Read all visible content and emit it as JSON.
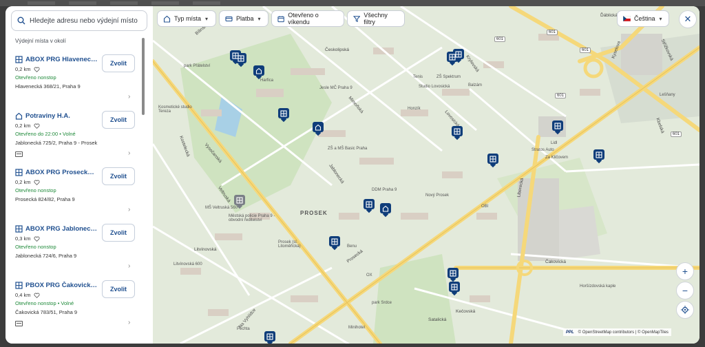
{
  "search": {
    "placeholder": "Hledejte adresu nebo výdejní místo"
  },
  "sidebar": {
    "section_label": "Výdejní místa v okolí",
    "select_label": "Zvolit",
    "places": [
      {
        "type": "box",
        "name": "ABOX PRG Hlavenecká",
        "distance": "0,2 km",
        "hours": "Otevřeno nonstop",
        "address": "Hlavenecká 368/21, Praha 9",
        "card": false
      },
      {
        "type": "shop",
        "name": "Potraviny H.A.",
        "distance": "0,2 km",
        "hours": "Otevřeno do 22:00  •  Volné",
        "address": "Jablonecká 725/2, Praha 9 - Prosek",
        "card": true
      },
      {
        "type": "box",
        "name": "ABOX PRG Prosecká (Pen...",
        "distance": "0,2 km",
        "hours": "Otevřeno nonstop",
        "address": "Prosecká 824/82, Praha 9",
        "card": false
      },
      {
        "type": "box",
        "name": "ABOX PRG Jablonecká (Ú...",
        "distance": "0,3 km",
        "hours": "Otevřeno nonstop",
        "address": "Jablonecká 724/6, Praha 9",
        "card": false
      },
      {
        "type": "box",
        "name": "PBOX PRG Čakovická (VÚ...",
        "distance": "0,4 km",
        "hours": "Otevřeno nonstop  •  Volné",
        "address": "Čakovická 783/51, Praha 9",
        "card": true
      }
    ]
  },
  "filters": {
    "type": "Typ místa",
    "payment": "Platba",
    "weekend": "Otevřeno o víkendu",
    "all": "Všechny filtry",
    "language": "Čeština"
  },
  "map": {
    "district": "PROSEK",
    "roads": [
      "Vysočanská",
      "Prosecká",
      "Jablonecká",
      "Čakovická",
      "Liberecká",
      "Kbelská",
      "Lovosická",
      "Litvínovská",
      "Ďáblická",
      "Krylovská",
      "Veltruská",
      "Mimoňská",
      "Kostelecká",
      "Českolipská",
      "Bílinská",
      "Kyselova",
      "Střížkovská",
      "Na Vyhlídce",
      "Kečovská",
      "Satalická",
      "Vysočanská",
      "Novovysočanská",
      "Kelčovická",
      "Burešova",
      "Jiříčská",
      "Děčínská",
      "Bratrská",
      "Nad Kundratkou",
      "Na Proseku"
    ],
    "pois": [
      "park Přátelství",
      "Harfica",
      "Jesle MČ Praha 9",
      "ZŠ Spektrum",
      "Balzám",
      "Studio Lovosická",
      "Honzík",
      "ZŠ a MŠ Basic Praha",
      "DDM Praha 9",
      "Nový Prosek",
      "OBI",
      "Lidl",
      "Stratos Auto",
      "Za Kličovem",
      "MŠ Veltruská 560",
      "Městská policie Praha 9 - obvodní ředitelství",
      "Benu",
      "Prosek (sl. Litoměřická)",
      "OX",
      "park Srdce",
      "Minihotel",
      "Pěchta",
      "Kosmetické studio Tereza",
      "Horšízdovská kaple",
      "Litvínovská 600",
      "Tenis",
      "Lešňany"
    ],
    "shields": [
      "601",
      "601",
      "601",
      "601",
      "601"
    ],
    "attribution": "© OpenStreetMap contributors | © OpenMapTiles",
    "ppl": "PPL"
  },
  "colors": {
    "accent": "#1f4f8f",
    "open": "#1f8a3a",
    "pin": "#0f3d7a",
    "road_major": "#f5d87a"
  }
}
